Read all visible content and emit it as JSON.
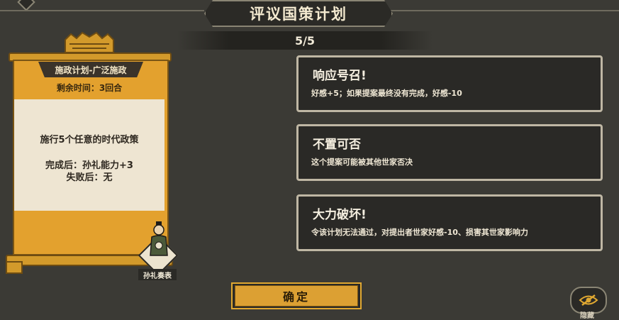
{
  "title": "评议国策计划",
  "counter": "5/5",
  "plan": {
    "crest_text": "??",
    "header": "施政计划-广泛施政",
    "remaining": "剩余时间：3回合",
    "goal": "施行5个任意的时代政策",
    "on_success": "完成后：孙礼能力+3",
    "on_fail": "失败后：无",
    "representative": "孙礼奏表"
  },
  "options": [
    {
      "title": "响应号召!",
      "desc": "好感+5；如果提案最终没有完成，好感-10"
    },
    {
      "title": "不置可否",
      "desc": "这个提案可能被其他世家否决"
    },
    {
      "title": "大力破坏!",
      "desc": "令该计划无法通过，对提出者世家好感-10、损害其世家影响力"
    }
  ],
  "confirm_label": "确定",
  "hide_label": "隐藏",
  "colors": {
    "gold": "#e3a12e",
    "panel": "#2a2926",
    "background": "#3b3a35"
  },
  "icons": {
    "hide": "eye-slash-icon",
    "crest": "crest-icon"
  }
}
